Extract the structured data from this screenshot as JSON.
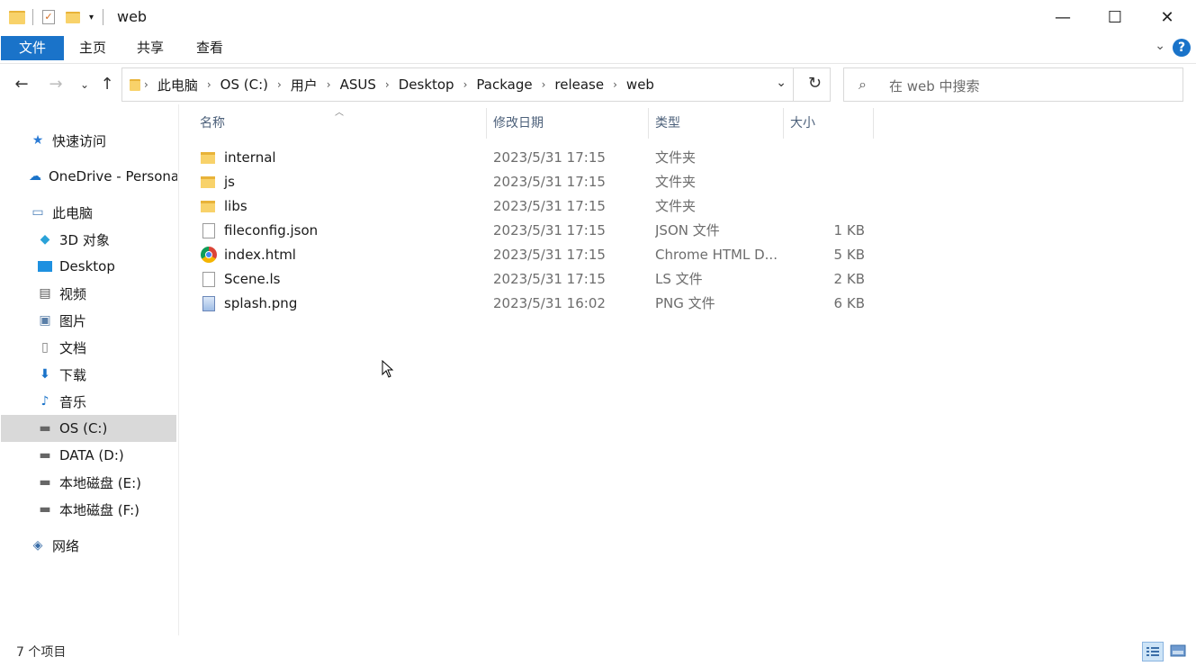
{
  "window": {
    "title": "web"
  },
  "window_controls": {
    "minimize": "—",
    "maximize": "☐",
    "close": "✕"
  },
  "ribbon": {
    "tabs": [
      {
        "label": "文件"
      },
      {
        "label": "主页"
      },
      {
        "label": "共享"
      },
      {
        "label": "查看"
      }
    ],
    "help": "?"
  },
  "address": {
    "crumbs": [
      "此电脑",
      "OS (C:)",
      "用户",
      "ASUS",
      "Desktop",
      "Package",
      "release",
      "web"
    ]
  },
  "search": {
    "placeholder": "在 web 中搜索"
  },
  "sidebar": {
    "items": [
      {
        "label": "快速访问",
        "icon": "star-icon"
      },
      {
        "label": "OneDrive - Persona",
        "icon": "cloud-icon"
      },
      {
        "label": "此电脑",
        "icon": "computer-icon"
      },
      {
        "label": "3D 对象",
        "icon": "cube-icon"
      },
      {
        "label": "Desktop",
        "icon": "desktop-icon"
      },
      {
        "label": "视频",
        "icon": "video-icon"
      },
      {
        "label": "图片",
        "icon": "pictures-icon"
      },
      {
        "label": "文档",
        "icon": "document-icon"
      },
      {
        "label": "下载",
        "icon": "download-icon"
      },
      {
        "label": "音乐",
        "icon": "music-icon"
      },
      {
        "label": "OS (C:)",
        "icon": "drive-icon",
        "selected": true
      },
      {
        "label": "DATA (D:)",
        "icon": "drive-icon"
      },
      {
        "label": "本地磁盘 (E:)",
        "icon": "drive-icon"
      },
      {
        "label": "本地磁盘 (F:)",
        "icon": "drive-icon"
      },
      {
        "label": "网络",
        "icon": "network-icon"
      }
    ]
  },
  "columns": {
    "name": "名称",
    "date": "修改日期",
    "type": "类型",
    "size": "大小"
  },
  "files": [
    {
      "name": "internal",
      "date": "2023/5/31 17:15",
      "type": "文件夹",
      "size": "",
      "icon": "folder-icon"
    },
    {
      "name": "js",
      "date": "2023/5/31 17:15",
      "type": "文件夹",
      "size": "",
      "icon": "folder-icon"
    },
    {
      "name": "libs",
      "date": "2023/5/31 17:15",
      "type": "文件夹",
      "size": "",
      "icon": "folder-icon"
    },
    {
      "name": "fileconfig.json",
      "date": "2023/5/31 17:15",
      "type": "JSON 文件",
      "size": "1 KB",
      "icon": "json-file-icon"
    },
    {
      "name": "index.html",
      "date": "2023/5/31 17:15",
      "type": "Chrome HTML D...",
      "size": "5 KB",
      "icon": "chrome-icon"
    },
    {
      "name": "Scene.ls",
      "date": "2023/5/31 17:15",
      "type": "LS 文件",
      "size": "2 KB",
      "icon": "file-icon"
    },
    {
      "name": "splash.png",
      "date": "2023/5/31 16:02",
      "type": "PNG 文件",
      "size": "6 KB",
      "icon": "image-file-icon"
    }
  ],
  "status": {
    "count": "7 个项目"
  }
}
